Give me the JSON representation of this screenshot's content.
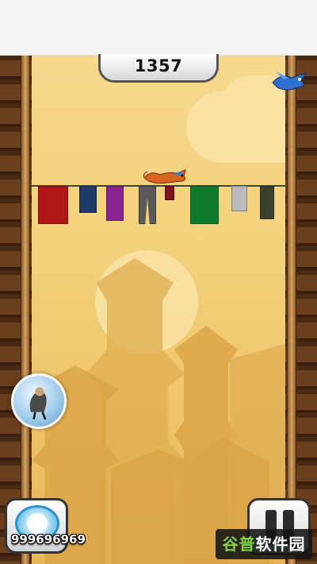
{
  "game": {
    "score": "1357",
    "coins": "999696969",
    "watermark": {
      "brand": "谷普",
      "rest": "软件园"
    },
    "clothesline": {
      "colors": [
        "#b01616",
        "#1e3a6b",
        "#8a2590",
        "#5a5a5a",
        "#7b1620",
        "#0f7a2a",
        "#b9b9b9",
        "#3a3f2a"
      ]
    },
    "icons": [
      "fox-character",
      "blue-bird-enemy",
      "bubble-shield-powerup",
      "coin-shop-icon",
      "pause-icon"
    ]
  }
}
